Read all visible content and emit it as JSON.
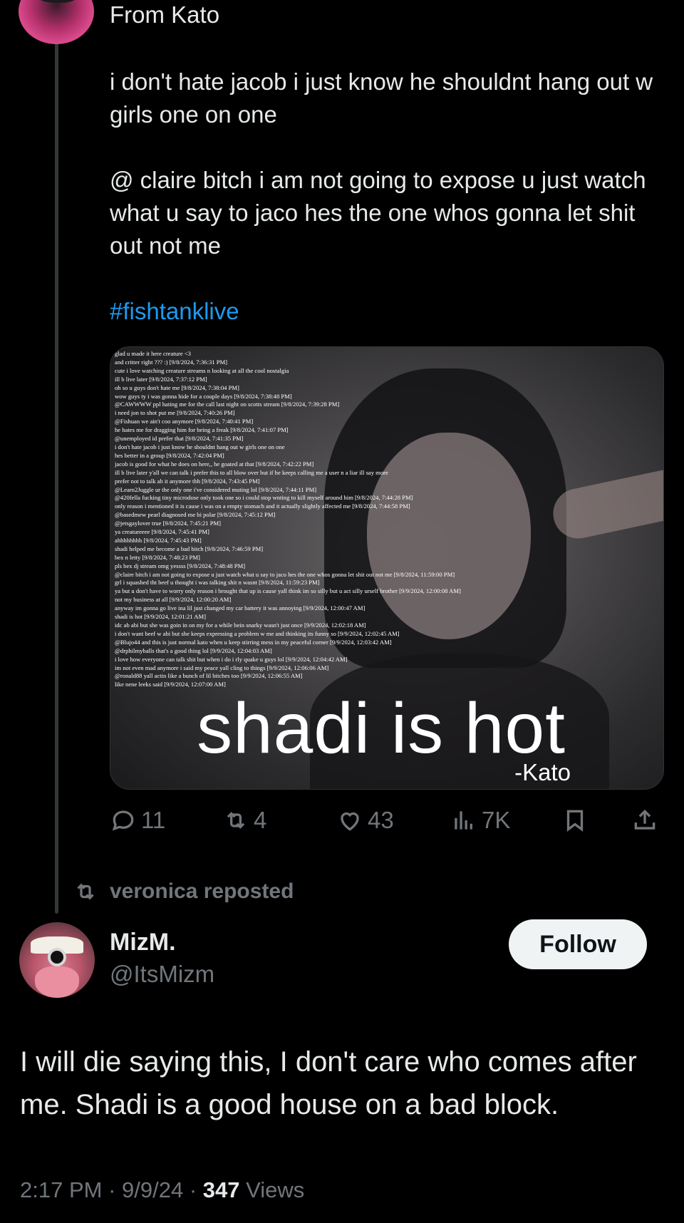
{
  "quoted_tweet": {
    "first_line": "From Kato",
    "paragraphs": [
      "i don't hate jacob i just know he shouldnt hang out w girls one on one",
      "@ claire bitch i am not going to expose u just watch what u say to jaco hes the one whos gonna let shit out not me"
    ],
    "hashtag": "#fishtanklive",
    "media": {
      "log_lines": [
        "glad u made it here creature <3",
        "and critter right ??? :) [9/8/2024, 7:36:31 PM]",
        "cute i love watching creature streams n looking at all the cool nostalgia",
        "ill b live later [9/8/2024, 7:37:12 PM]",
        "oh so u guys don't hate me [9/8/2024, 7:38:04 PM]",
        "wow guys ty i was gonna hide for a couple days [9/8/2024, 7:38:48 PM]",
        "@CAWWWW ppl hating me for the call last night on scotts stream [9/8/2024, 7:39:28 PM]",
        "i need jon to shot put me [9/8/2024, 7:40:26 PM]",
        "@Fishuan we ain't coo anymore [9/8/2024, 7:40:41 PM]",
        "he hates me for dragging him for being a freak [9/8/2024, 7:41:07 PM]",
        "@unemployed id prefer that [9/8/2024, 7:41:35 PM]",
        "i don't hate jacob i just know he shouldnt hang out w girls one on one",
        "hes better in a group [9/8/2024, 7:42:04 PM]",
        "jacob is good for what he does on here,, he goated at that [9/8/2024, 7:42:22 PM]",
        "ill b live later y'all we can talk i prefer this to all blow over but if he keeps calling me a user n a liar ill say more",
        "prefer not to talk ab it anymore tbh [9/8/2024, 7:43:45 PM]",
        "@Learn2Juggle ur the only one i've considered muting lol [9/8/2024, 7:44:11 PM]",
        "@420fella fucking tiny microdose only took one so i could stop wnting to kill myself around him [9/8/2024, 7:44:28 PM]",
        "only reason i mentioned it is cause i was on a empty stomach and it actually slightly affected me [9/8/2024, 7:44:58 PM]",
        "@basedmew pearl diagnosed me bi polar [9/8/2024, 7:45:12 PM]",
        "@jetsgaylover true [9/8/2024, 7:45:21 PM]",
        "ya creatureeee [9/8/2024, 7:45:41 PM]",
        "ahhhhhhhh [9/8/2024, 7:45:43 PM]",
        "shadi helped me become a bad bitch [9/8/2024, 7:46:59 PM]",
        "bex n letty [9/8/2024, 7:48:23 PM]",
        "pls bex dj stream omg yessss [9/8/2024, 7:48:48 PM]",
        "@claire bitch i am not going to expose u just watch what u say to jaco hes the one whos gonna let shit out not me [9/8/2024, 11:59:00 PM]",
        "grl i squashed tht beef u thought i was talking shit n wasnt [9/8/2024, 11:59:23 PM]",
        "ya but u don't have to worry only reason i brought that up is cause yall think im so silly but u act silly urself brother [9/9/2024, 12:00:08 AM]",
        "not my business at all [9/9/2024, 12:00:20 AM]",
        "anyway im gonna go live ina lil just changed my car battery it was annoying [9/9/2024, 12:00:47 AM]",
        "shadi is hot [9/9/2024, 12:01:21 AM]",
        "idc ab abi but she was goin in on my for a while bein snarky wasn't just once [9/9/2024, 12:02:18 AM]",
        "i don't want beef w abi but she keeps expressing a problem w me and thinking its funny so [9/9/2024, 12:02:45 AM]",
        "@Blujo44 and this is just normal kato when u keep stirring mess in my peaceful corner [9/9/2024, 12:03:42 AM]",
        "@drphilmyballs that's a good thing lol [9/9/2024, 12:04:03 AM]",
        "i love how everyone can talk shit but when i do i rly quake u guys lol [9/9/2024, 12:04:42 AM]",
        "im not even mad anymore i said my peace yall cling to things [9/9/2024, 12:06:06 AM]",
        "@ronald88 yall actin like a bunch of lil bitches too [9/9/2024, 12:06:55 AM]",
        "like nene leeks said [9/9/2024, 12:07:00 AM]"
      ],
      "caption": "shadi is hot",
      "signature": "-Kato"
    },
    "actions": {
      "replies": "11",
      "reposts": "4",
      "likes": "43",
      "views": "7K"
    }
  },
  "repost_label": "veronica reposted",
  "tweet": {
    "display_name": "MizM.",
    "handle": "@ItsMizm",
    "follow_label": "Follow",
    "text": "I will die saying this, I don't care who comes after me. Shadi is a good house on a bad block.",
    "time": "2:17 PM",
    "date": "9/9/24",
    "views_count": "347",
    "views_label": "Views"
  }
}
